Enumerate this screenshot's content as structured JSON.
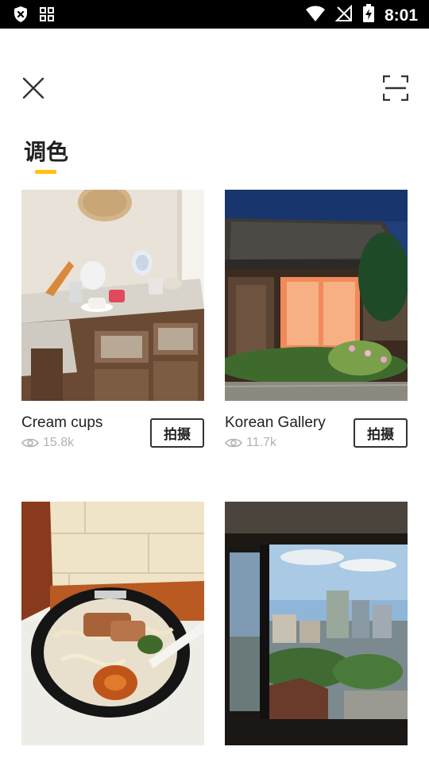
{
  "status_bar": {
    "time": "8:01",
    "icons": [
      "shield-x-icon",
      "grid-icon",
      "wifi-icon",
      "no-signal-icon",
      "battery-charging-icon"
    ]
  },
  "header": {
    "close_icon": "close-icon",
    "scan_icon": "scan-icon"
  },
  "section": {
    "title": "调色",
    "accent_color": "#ffc20e"
  },
  "cards": [
    {
      "title": "Cream cups",
      "views": "15.8k",
      "button": "拍摄",
      "image": "cream-cups-photo"
    },
    {
      "title": "Korean Gallery",
      "views": "11.7k",
      "button": "拍摄",
      "image": "korean-gallery-photo"
    },
    {
      "title": "",
      "views": "",
      "button": "",
      "image": "ramen-photo"
    },
    {
      "title": "",
      "views": "",
      "button": "",
      "image": "city-window-photo"
    }
  ]
}
